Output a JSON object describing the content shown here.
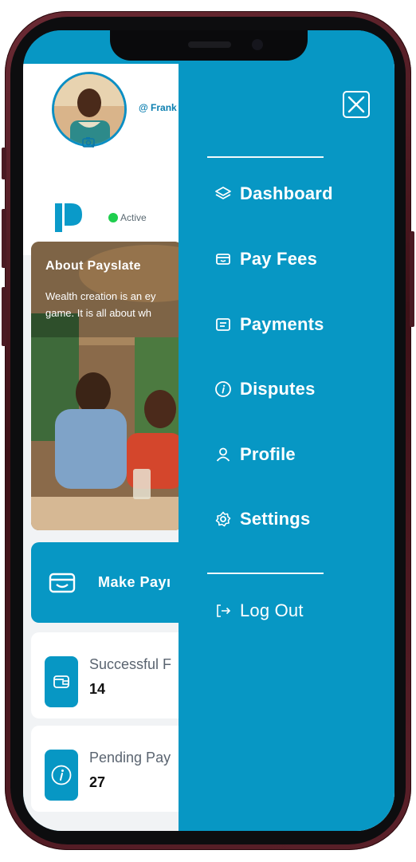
{
  "profile": {
    "handle": "@ Frank"
  },
  "status": {
    "label": "Active"
  },
  "about": {
    "title": "About Payslate",
    "text": "Wealth creation is an ey game. It is all about wh"
  },
  "actions": {
    "make_payment_label": "Make Payı"
  },
  "stats": [
    {
      "title": "Successful F",
      "value": "14",
      "icon": "wallet-icon"
    },
    {
      "title": "Pending Pay",
      "value": "27",
      "icon": "info-icon"
    }
  ],
  "menu": {
    "items": [
      {
        "label": "Dashboard",
        "icon": "layers-icon"
      },
      {
        "label": "Pay Fees",
        "icon": "card-icon"
      },
      {
        "label": "Payments",
        "icon": "receipt-icon"
      },
      {
        "label": "Disputes",
        "icon": "info-icon"
      },
      {
        "label": "Profile",
        "icon": "user-icon"
      },
      {
        "label": "Settings",
        "icon": "gear-icon"
      }
    ],
    "logout": {
      "label": "Log Out",
      "icon": "logout-icon"
    }
  },
  "colors": {
    "brand": "#0797c4",
    "active": "#1fce4e",
    "frame": "#4a1a22"
  }
}
